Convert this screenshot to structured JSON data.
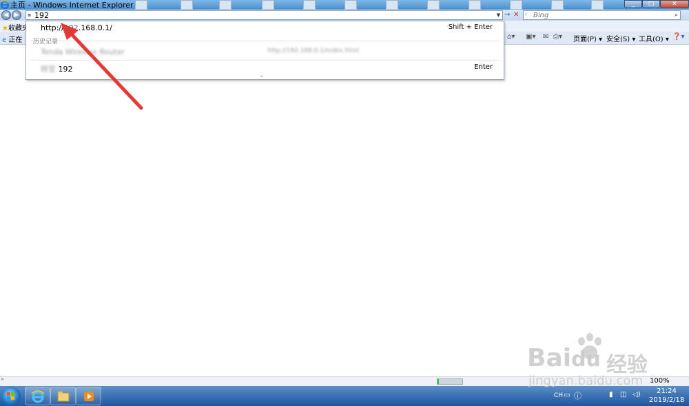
{
  "window": {
    "title": "主页 - Windows Internet Explorer",
    "buttons": {
      "minimize": "_",
      "maximize": "□",
      "close": "✕"
    }
  },
  "nav": {
    "back_icon": "back-arrow-icon",
    "forward_icon": "forward-arrow-icon",
    "address_value": "192",
    "go_glyph": "→",
    "stop_glyph": "✕",
    "search_placeholder": "Bing"
  },
  "favorites": {
    "label": "收藏夹"
  },
  "tab": {
    "label": "正在"
  },
  "command_bar": {
    "page": "页面(P) ▾",
    "safety": "安全(S) ▾",
    "tools": "工具(O) ▾"
  },
  "autocomplete": {
    "top_row": {
      "url_prefix": "http://",
      "url_match": "192",
      "url_suffix": ".168.0.1/",
      "shortcut": "Shift + Enter"
    },
    "section_header": "历史记录",
    "history_row": {
      "title": "Tenda Wireless Router",
      "url": "http://192.168.0.1/index.html"
    },
    "goto_row": {
      "label": "转至",
      "query": "192",
      "shortcut": "Enter"
    },
    "more_glyph": "⌄"
  },
  "status": {
    "progress": 0.05,
    "zoom": "100%",
    "accent_progress": "#2fbf38"
  },
  "taskbar": {
    "apps": [
      "internet-explorer-icon",
      "file-explorer-icon",
      "media-player-icon"
    ],
    "tray": {
      "language": "CH"
    },
    "clock": {
      "time": "21:24",
      "date": "2019/2/18"
    }
  },
  "annotation": {
    "color": "#e53935"
  },
  "watermark": {
    "brand": "Bai",
    "brand_tail": "du",
    "chinese": "经验",
    "url": "jingyan.baidu.com"
  }
}
